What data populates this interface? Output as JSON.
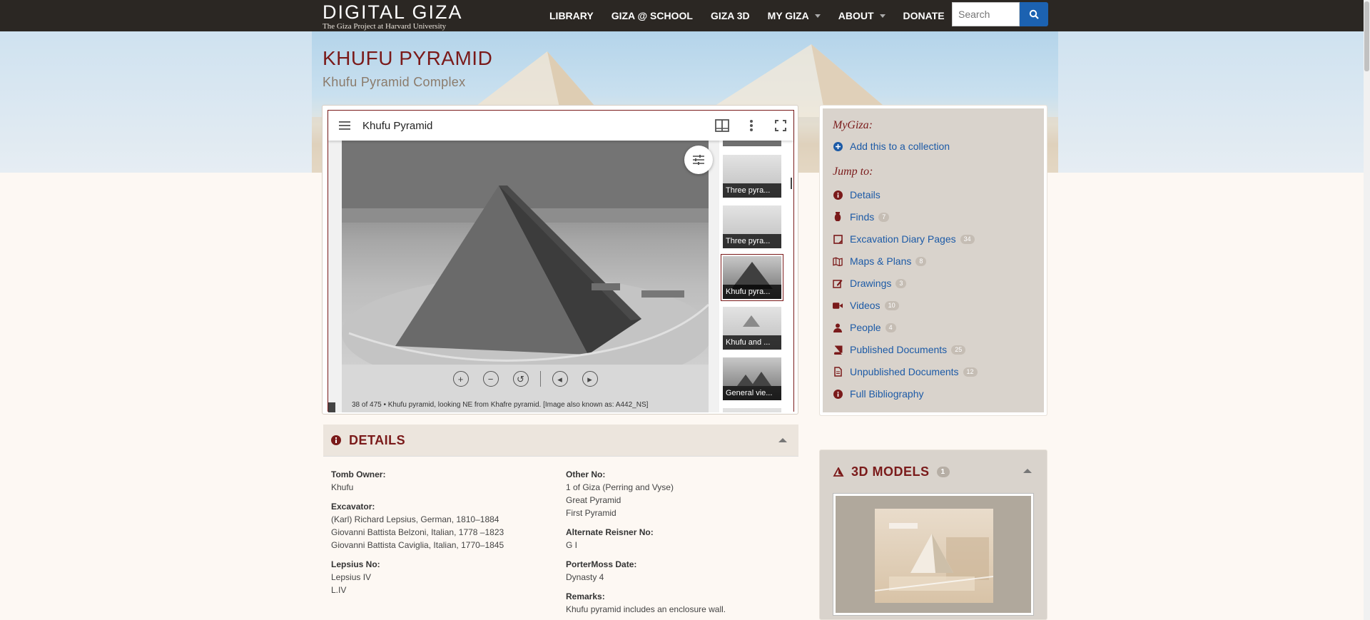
{
  "header": {
    "logo_text": "DIGITAL GIZA",
    "logo_sub": "The Giza Project at Harvard University",
    "nav": [
      {
        "label": "LIBRARY",
        "dropdown": false
      },
      {
        "label": "GIZA @ SCHOOL",
        "dropdown": false
      },
      {
        "label": "GIZA 3D",
        "dropdown": false
      },
      {
        "label": "MY GIZA",
        "dropdown": true
      },
      {
        "label": "ABOUT",
        "dropdown": true
      },
      {
        "label": "DONATE",
        "dropdown": false
      }
    ],
    "search_placeholder": "Search"
  },
  "page": {
    "title": "KHUFU PYRAMID",
    "subtitle": "Khufu Pyramid Complex"
  },
  "viewer": {
    "title": "Khufu Pyramid",
    "caption": "38 of 475 • Khufu pyramid, looking NE from Khafre pyramid. [Image also known as: A442_NS]",
    "thumbnails": [
      {
        "label": "Three pyra...",
        "active": false
      },
      {
        "label": "Three pyra...",
        "active": false
      },
      {
        "label": "Khufu pyra...",
        "active": true
      },
      {
        "label": "Khufu and ...",
        "active": false
      },
      {
        "label": "General vie...",
        "active": false
      }
    ],
    "controls": [
      "zoom-in",
      "zoom-out",
      "reset",
      "previous",
      "next"
    ]
  },
  "details": {
    "heading": "DETAILS",
    "left": [
      {
        "label": "Tomb Owner:",
        "values": [
          "Khufu"
        ]
      },
      {
        "label": "Excavator:",
        "values": [
          "(Karl) Richard Lepsius, German, 1810–1884",
          "Giovanni Battista Belzoni, Italian, 1778 –1823",
          "Giovanni Battista Caviglia, Italian, 1770–1845"
        ]
      },
      {
        "label": "Lepsius No:",
        "values": [
          "Lepsius IV",
          "L.IV"
        ]
      }
    ],
    "right": [
      {
        "label": "Other No:",
        "values": [
          "1 of Giza (Perring and Vyse)",
          "Great Pyramid",
          "First Pyramid"
        ]
      },
      {
        "label": "Alternate Reisner No:",
        "values": [
          "G I"
        ]
      },
      {
        "label": "PorterMoss Date:",
        "values": [
          "Dynasty 4"
        ]
      },
      {
        "label": "Remarks:",
        "values": [
          "Khufu pyramid includes an enclosure wall."
        ]
      }
    ]
  },
  "sidebar": {
    "mygiza_heading": "MyGiza:",
    "add_collection": "Add this to a collection",
    "jump_heading": "Jump to:",
    "links": [
      {
        "label": "Details",
        "count": "",
        "icon": "info-icon"
      },
      {
        "label": "Finds",
        "count": "7",
        "icon": "vase-icon"
      },
      {
        "label": "Excavation Diary Pages",
        "count": "34",
        "icon": "diary-icon"
      },
      {
        "label": "Maps & Plans",
        "count": "8",
        "icon": "map-icon"
      },
      {
        "label": "Drawings",
        "count": "3",
        "icon": "pencil-icon"
      },
      {
        "label": "Videos",
        "count": "10",
        "icon": "video-icon"
      },
      {
        "label": "People",
        "count": "4",
        "icon": "person-icon"
      },
      {
        "label": "Published Documents",
        "count": "25",
        "icon": "book-icon"
      },
      {
        "label": "Unpublished Documents",
        "count": "12",
        "icon": "document-icon"
      },
      {
        "label": "Full Bibliography",
        "count": "",
        "icon": "info-icon"
      }
    ]
  },
  "models": {
    "heading": "3D MODELS",
    "count": "1"
  },
  "colors": {
    "accent": "#7a1a1a",
    "link": "#1c5aa6",
    "nav_bg": "#2b2723",
    "search_button": "#1c62b1"
  }
}
